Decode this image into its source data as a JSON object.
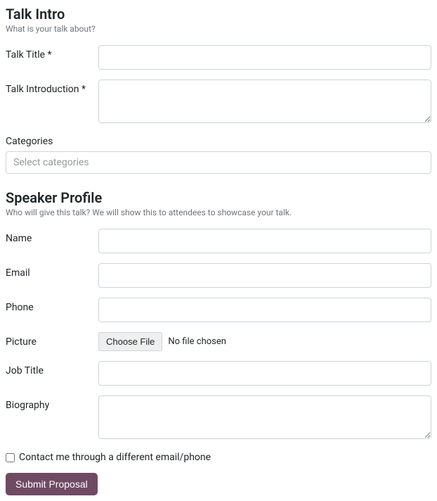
{
  "talk_intro": {
    "title": "Talk Intro",
    "subtitle": "What is your talk about?",
    "talk_title_label": "Talk Title *",
    "talk_title_value": "",
    "talk_intro_label": "Talk Introduction *",
    "talk_intro_value": "",
    "categories_label": "Categories",
    "categories_placeholder": "Select categories"
  },
  "speaker_profile": {
    "title": "Speaker Profile",
    "subtitle": "Who will give this talk? We will show this to attendees to showcase your talk.",
    "name_label": "Name",
    "name_value": "",
    "email_label": "Email",
    "email_value": "",
    "phone_label": "Phone",
    "phone_value": "",
    "picture_label": "Picture",
    "file_button_label": "Choose File",
    "file_status": "No file chosen",
    "job_title_label": "Job Title",
    "job_title_value": "",
    "biography_label": "Biography",
    "biography_value": ""
  },
  "contact_alt": {
    "label": "Contact me through a different email/phone",
    "checked": false
  },
  "submit_label": "Submit Proposal"
}
